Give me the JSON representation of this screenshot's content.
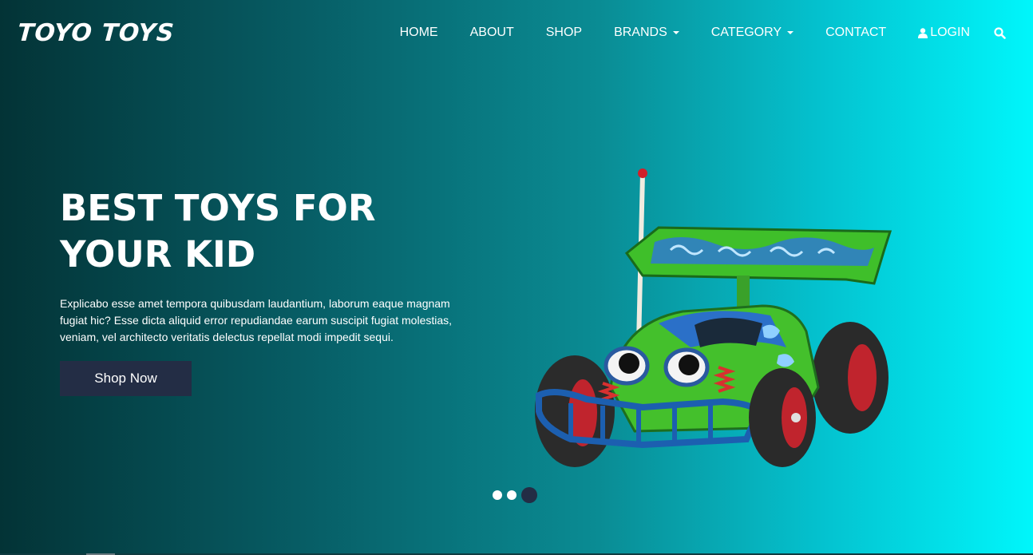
{
  "brand": {
    "logo": "TOYO TOYS"
  },
  "nav": {
    "items": [
      {
        "label": "HOME"
      },
      {
        "label": "ABOUT"
      },
      {
        "label": "SHOP"
      },
      {
        "label": "BRANDS"
      },
      {
        "label": "CATEGORY"
      },
      {
        "label": "CONTACT"
      },
      {
        "label": "LOGIN"
      }
    ]
  },
  "hero": {
    "headline_line1": "BEST TOYS FOR",
    "headline_line2": "YOUR KID",
    "description": "Explicabo esse amet tempora quibusdam laudantium, laborum eaque magnam fugiat hic? Esse dicta aliquid error repudiandae earum suscipit fugiat molestias, veniam, vel architecto veritatis delectus repellat modi impedit sequi.",
    "button_label": "Shop Now"
  },
  "carousel": {
    "slide_count": 3,
    "active_index": 2
  },
  "icons": {
    "user": "user-icon",
    "search": "search-icon",
    "dropdown": "caret-down-icon"
  },
  "colors": {
    "gradient_start": "#033336",
    "gradient_end": "#00f6fb",
    "button_bg": "#232d45",
    "text": "#ffffff"
  }
}
